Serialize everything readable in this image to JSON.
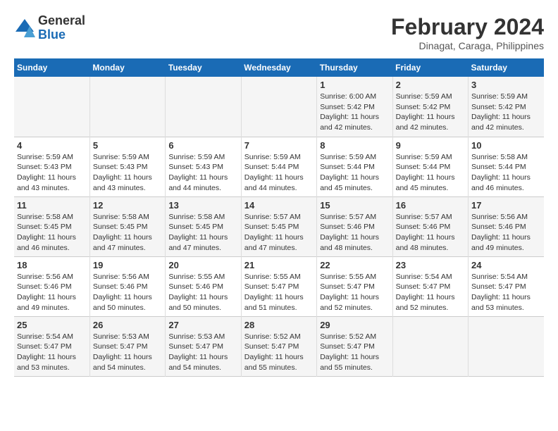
{
  "logo": {
    "general": "General",
    "blue": "Blue"
  },
  "title": {
    "month_year": "February 2024",
    "location": "Dinagat, Caraga, Philippines"
  },
  "headers": [
    "Sunday",
    "Monday",
    "Tuesday",
    "Wednesday",
    "Thursday",
    "Friday",
    "Saturday"
  ],
  "weeks": [
    [
      {
        "day": "",
        "info": ""
      },
      {
        "day": "",
        "info": ""
      },
      {
        "day": "",
        "info": ""
      },
      {
        "day": "",
        "info": ""
      },
      {
        "day": "1",
        "info": "Sunrise: 6:00 AM\nSunset: 5:42 PM\nDaylight: 11 hours\nand 42 minutes."
      },
      {
        "day": "2",
        "info": "Sunrise: 5:59 AM\nSunset: 5:42 PM\nDaylight: 11 hours\nand 42 minutes."
      },
      {
        "day": "3",
        "info": "Sunrise: 5:59 AM\nSunset: 5:42 PM\nDaylight: 11 hours\nand 42 minutes."
      }
    ],
    [
      {
        "day": "4",
        "info": "Sunrise: 5:59 AM\nSunset: 5:43 PM\nDaylight: 11 hours\nand 43 minutes."
      },
      {
        "day": "5",
        "info": "Sunrise: 5:59 AM\nSunset: 5:43 PM\nDaylight: 11 hours\nand 43 minutes."
      },
      {
        "day": "6",
        "info": "Sunrise: 5:59 AM\nSunset: 5:43 PM\nDaylight: 11 hours\nand 44 minutes."
      },
      {
        "day": "7",
        "info": "Sunrise: 5:59 AM\nSunset: 5:44 PM\nDaylight: 11 hours\nand 44 minutes."
      },
      {
        "day": "8",
        "info": "Sunrise: 5:59 AM\nSunset: 5:44 PM\nDaylight: 11 hours\nand 45 minutes."
      },
      {
        "day": "9",
        "info": "Sunrise: 5:59 AM\nSunset: 5:44 PM\nDaylight: 11 hours\nand 45 minutes."
      },
      {
        "day": "10",
        "info": "Sunrise: 5:58 AM\nSunset: 5:44 PM\nDaylight: 11 hours\nand 46 minutes."
      }
    ],
    [
      {
        "day": "11",
        "info": "Sunrise: 5:58 AM\nSunset: 5:45 PM\nDaylight: 11 hours\nand 46 minutes."
      },
      {
        "day": "12",
        "info": "Sunrise: 5:58 AM\nSunset: 5:45 PM\nDaylight: 11 hours\nand 47 minutes."
      },
      {
        "day": "13",
        "info": "Sunrise: 5:58 AM\nSunset: 5:45 PM\nDaylight: 11 hours\nand 47 minutes."
      },
      {
        "day": "14",
        "info": "Sunrise: 5:57 AM\nSunset: 5:45 PM\nDaylight: 11 hours\nand 47 minutes."
      },
      {
        "day": "15",
        "info": "Sunrise: 5:57 AM\nSunset: 5:46 PM\nDaylight: 11 hours\nand 48 minutes."
      },
      {
        "day": "16",
        "info": "Sunrise: 5:57 AM\nSunset: 5:46 PM\nDaylight: 11 hours\nand 48 minutes."
      },
      {
        "day": "17",
        "info": "Sunrise: 5:56 AM\nSunset: 5:46 PM\nDaylight: 11 hours\nand 49 minutes."
      }
    ],
    [
      {
        "day": "18",
        "info": "Sunrise: 5:56 AM\nSunset: 5:46 PM\nDaylight: 11 hours\nand 49 minutes."
      },
      {
        "day": "19",
        "info": "Sunrise: 5:56 AM\nSunset: 5:46 PM\nDaylight: 11 hours\nand 50 minutes."
      },
      {
        "day": "20",
        "info": "Sunrise: 5:55 AM\nSunset: 5:46 PM\nDaylight: 11 hours\nand 50 minutes."
      },
      {
        "day": "21",
        "info": "Sunrise: 5:55 AM\nSunset: 5:47 PM\nDaylight: 11 hours\nand 51 minutes."
      },
      {
        "day": "22",
        "info": "Sunrise: 5:55 AM\nSunset: 5:47 PM\nDaylight: 11 hours\nand 52 minutes."
      },
      {
        "day": "23",
        "info": "Sunrise: 5:54 AM\nSunset: 5:47 PM\nDaylight: 11 hours\nand 52 minutes."
      },
      {
        "day": "24",
        "info": "Sunrise: 5:54 AM\nSunset: 5:47 PM\nDaylight: 11 hours\nand 53 minutes."
      }
    ],
    [
      {
        "day": "25",
        "info": "Sunrise: 5:54 AM\nSunset: 5:47 PM\nDaylight: 11 hours\nand 53 minutes."
      },
      {
        "day": "26",
        "info": "Sunrise: 5:53 AM\nSunset: 5:47 PM\nDaylight: 11 hours\nand 54 minutes."
      },
      {
        "day": "27",
        "info": "Sunrise: 5:53 AM\nSunset: 5:47 PM\nDaylight: 11 hours\nand 54 minutes."
      },
      {
        "day": "28",
        "info": "Sunrise: 5:52 AM\nSunset: 5:47 PM\nDaylight: 11 hours\nand 55 minutes."
      },
      {
        "day": "29",
        "info": "Sunrise: 5:52 AM\nSunset: 5:47 PM\nDaylight: 11 hours\nand 55 minutes."
      },
      {
        "day": "",
        "info": ""
      },
      {
        "day": "",
        "info": ""
      }
    ]
  ]
}
